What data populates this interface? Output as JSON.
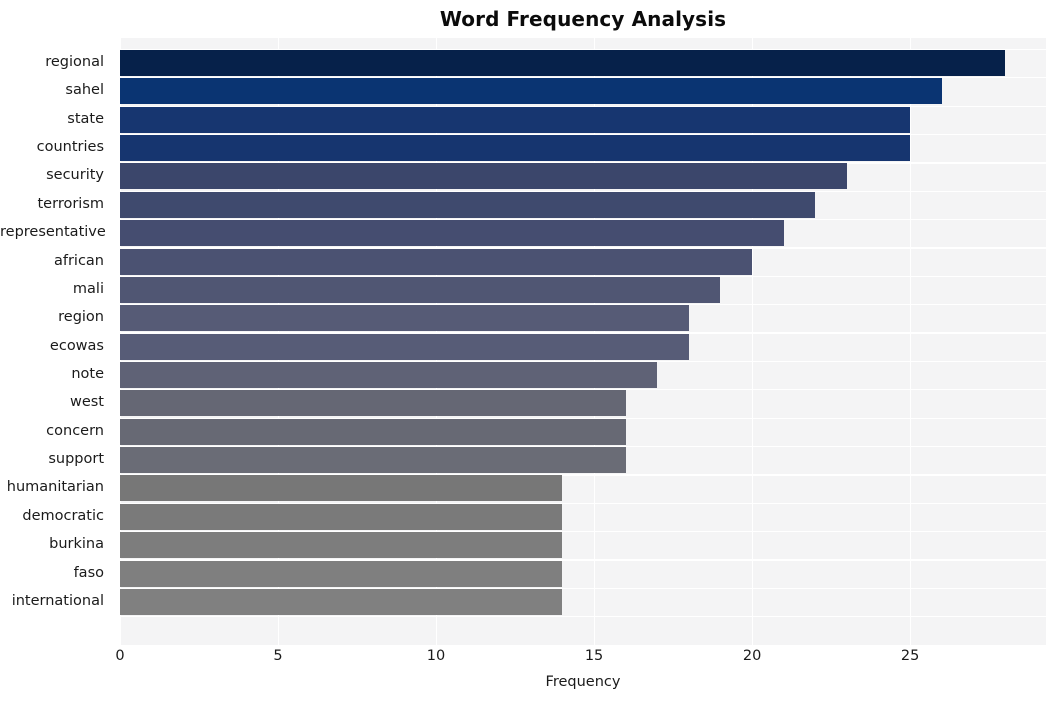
{
  "chart_data": {
    "type": "bar",
    "orientation": "horizontal",
    "title": "Word Frequency Analysis",
    "xlabel": "Frequency",
    "ylabel": "",
    "categories": [
      "regional",
      "sahel",
      "state",
      "countries",
      "security",
      "terrorism",
      "representative",
      "african",
      "mali",
      "region",
      "ecowas",
      "note",
      "west",
      "concern",
      "support",
      "humanitarian",
      "democratic",
      "burkina",
      "faso",
      "international"
    ],
    "values": [
      28,
      26,
      25,
      25,
      23,
      22,
      21,
      20,
      19,
      18,
      18,
      17,
      16,
      16,
      16,
      14,
      14,
      14,
      14,
      14
    ],
    "bar_colors": [
      "#06214a",
      "#0a3472",
      "#173670",
      "#16356f",
      "#3b466b",
      "#3f4a6e",
      "#454d70",
      "#4b5272",
      "#505673",
      "#565b76",
      "#575c77",
      "#5f6276",
      "#656774",
      "#676974",
      "#6a6c76",
      "#777777",
      "#7a7a7a",
      "#7d7d7d",
      "#7f7f7f",
      "#808080"
    ],
    "xticks": [
      0,
      5,
      10,
      15,
      20,
      25
    ],
    "xlim": [
      0,
      29.3
    ],
    "grid": true,
    "grid_color": "#ffffff",
    "plot_background": "#f4f4f5",
    "figure_background": "#ffffff",
    "legend": null
  }
}
